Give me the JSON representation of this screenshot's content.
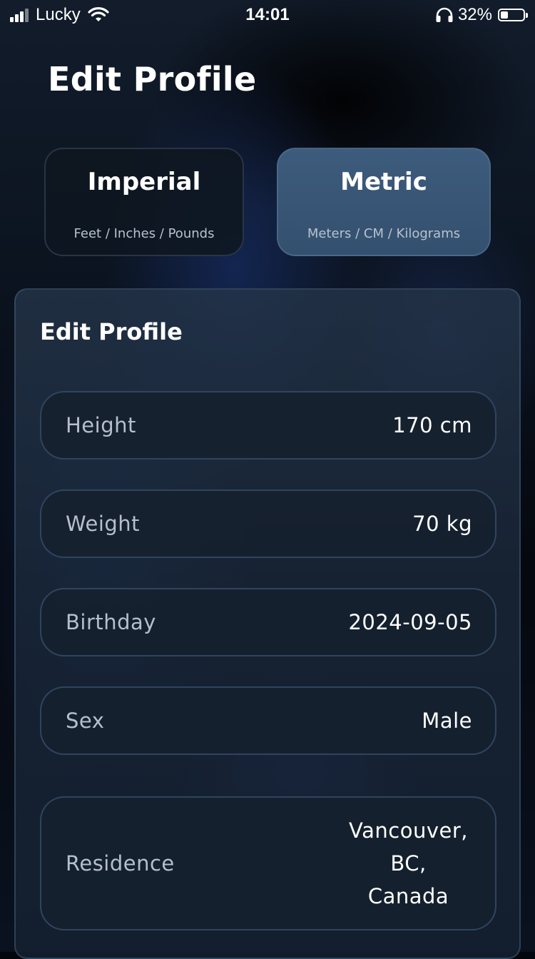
{
  "status_bar": {
    "carrier": "Lucky",
    "time": "14:01",
    "battery_percent": "32%",
    "battery_level": 0.32,
    "icons": [
      "signal-icon",
      "wifi-icon",
      "headphones-icon",
      "battery-icon"
    ]
  },
  "header": {
    "title": "Edit Profile"
  },
  "units": {
    "selected": "Metric",
    "options": [
      {
        "title": "Imperial",
        "subtitle": "Feet / Inches / Pounds"
      },
      {
        "title": "Metric",
        "subtitle": "Meters / CM / Kilograms"
      }
    ]
  },
  "panel": {
    "title": "Edit Profile",
    "fields": [
      {
        "label": "Height",
        "value": "170 cm"
      },
      {
        "label": "Weight",
        "value": "70 kg"
      },
      {
        "label": "Birthday",
        "value": "2024-09-05"
      },
      {
        "label": "Sex",
        "value": "Male"
      },
      {
        "label": "Residence",
        "value_lines": [
          "Vancouver,",
          "BC,",
          "Canada"
        ]
      }
    ]
  },
  "colors": {
    "selected_unit": "#3d5b7c",
    "field_background": "#16212f",
    "label_text": "#b6bfca"
  }
}
